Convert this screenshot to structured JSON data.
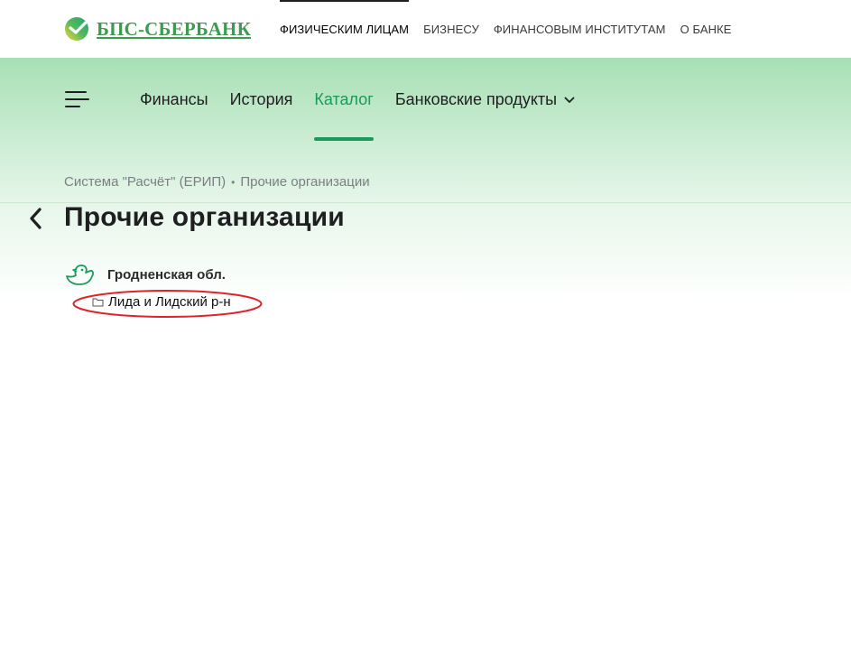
{
  "brand": {
    "name": "БПС-СБЕРБАНК",
    "color": "#3d9a4f",
    "icon": "sberbank-logo-icon"
  },
  "top_nav": {
    "items": [
      {
        "label": "ФИЗИЧЕСКИМ ЛИЦАМ",
        "active": true
      },
      {
        "label": "БИЗНЕСУ",
        "active": false
      },
      {
        "label": "ФИНАНСОВЫМ ИНСТИТУТАМ",
        "active": false
      },
      {
        "label": "О БАНКЕ",
        "active": false
      }
    ]
  },
  "sec_nav": {
    "menu_icon": "hamburger-menu-icon",
    "items": [
      {
        "label": "Финансы",
        "active": false
      },
      {
        "label": "История",
        "active": false
      },
      {
        "label": "Каталог",
        "active": true
      },
      {
        "label": "Банковские продукты",
        "active": false,
        "dropdown": true
      }
    ],
    "accent_color": "#1a9a5b"
  },
  "breadcrumb": {
    "items": [
      "Система \"Расчёт\" (ЕРИП)",
      "Прочие организации"
    ],
    "separator": "•"
  },
  "page": {
    "title": "Прочие организации"
  },
  "tree": {
    "region": {
      "label": "Гродненская обл.",
      "icon": "duck-icon"
    },
    "items": [
      {
        "label": "Лида и Лидский р-н",
        "icon": "folder-icon",
        "highlighted": true
      }
    ]
  },
  "annotation": {
    "color": "#e0232a"
  }
}
